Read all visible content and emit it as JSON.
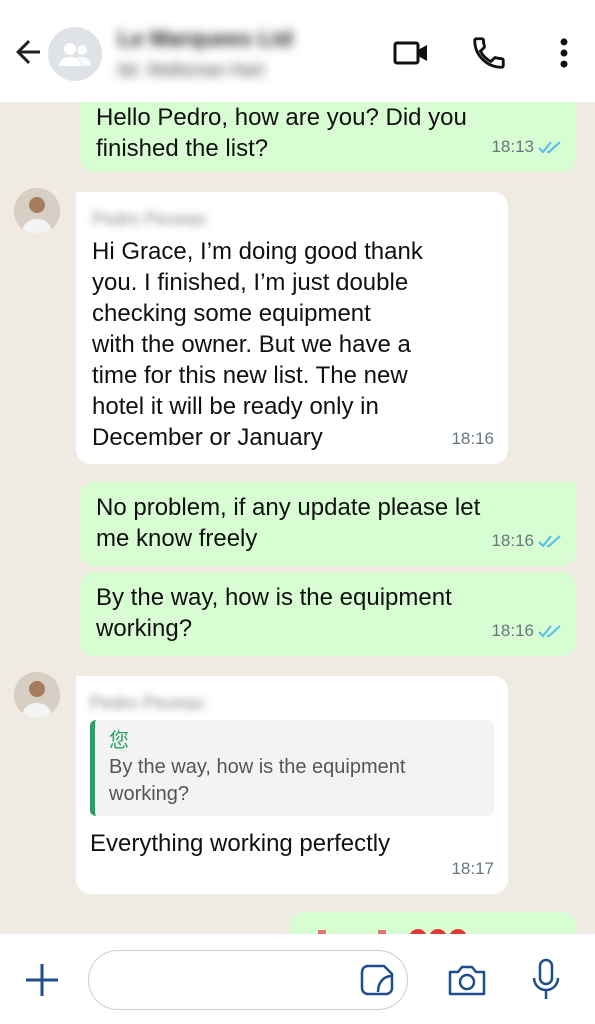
{
  "header": {
    "title": "Le Marquees Ltd",
    "subtitle": "ltd. Wallsman Hart",
    "icons": [
      "back-arrow-icon",
      "group-avatar-icon",
      "video-call-icon",
      "phone-call-icon",
      "more-vert-icon"
    ]
  },
  "messages": [
    {
      "text": "Hello Pedro, how are you? Did you\nfinished the list?",
      "time": "18:13"
    },
    {
      "sender": "Pedro Pecego",
      "text": "Hi Grace, I’m doing good thank\nyou. I finished, I’m just double\nchecking some equipment\nwith the owner. But we have a\ntime for this new list. The new\nhotel it will be ready only in\nDecember or January",
      "time": "18:16"
    },
    {
      "text": "No problem, if any update please let\nme know freely",
      "time": "18:16"
    },
    {
      "text": "By the way, how is the equipment\nworking?",
      "time": "18:16"
    },
    {
      "sender": "Pedro Pecego",
      "quote_author": "您",
      "quote_text": "By the way, how is the equipment\nworking?",
      "text": "Everything working perfectly",
      "time": "18:17"
    }
  ],
  "composer": {
    "placeholder": "",
    "icons": [
      "plus-icon",
      "sticker-icon",
      "camera-icon",
      "mic-icon"
    ]
  },
  "colors": {
    "outgoing": "#d9fdd3",
    "incoming": "#ffffff",
    "accent": "#25a266",
    "read_ticks": "#53bdeb"
  }
}
